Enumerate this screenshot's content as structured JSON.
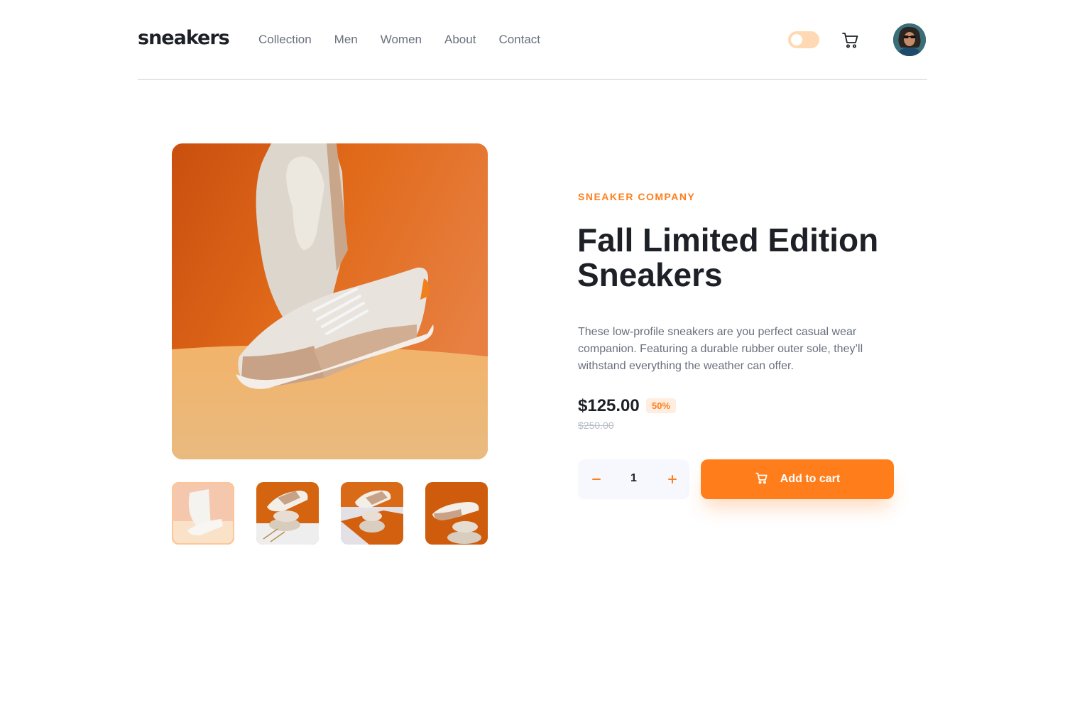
{
  "header": {
    "logo": "sneakers",
    "nav": [
      "Collection",
      "Men",
      "Women",
      "About",
      "Contact"
    ],
    "theme_toggle_state": "off"
  },
  "gallery": {
    "selected_thumbnail": 1,
    "thumbnail_count": 4
  },
  "product": {
    "brand": "SNEAKER COMPANY",
    "title_line1": "Fall Limited Edition",
    "title_line2": "Sneakers",
    "description": "These low-profile sneakers are you perfect casual wear companion. Featuring a durable rubber outer sole, they’ll withstand everything the weather can offer.",
    "price": "$125.00",
    "discount": "50%",
    "original_price": "$250.00"
  },
  "cart": {
    "quantity": "1",
    "add_label": "Add to cart"
  },
  "colors": {
    "accent": "#ff7e1b",
    "text_dark": "#1d2026",
    "text_muted": "#69707d"
  }
}
